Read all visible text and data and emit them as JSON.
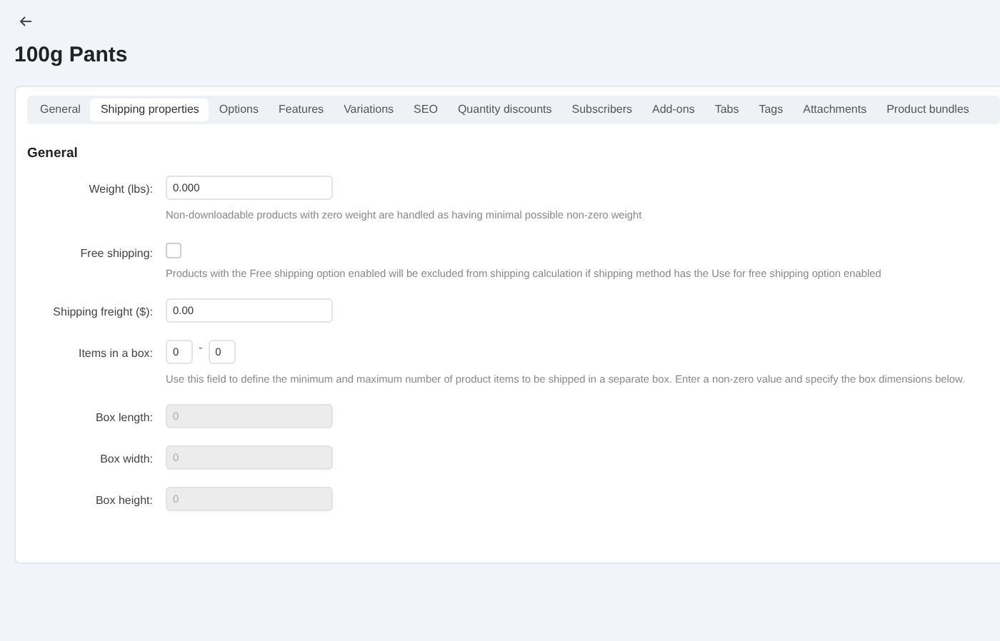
{
  "header": {
    "title": "100g Pants"
  },
  "tabs": [
    {
      "label": "General",
      "selected": false
    },
    {
      "label": "Shipping properties",
      "selected": true
    },
    {
      "label": "Options",
      "selected": false
    },
    {
      "label": "Features",
      "selected": false
    },
    {
      "label": "Variations",
      "selected": false
    },
    {
      "label": "SEO",
      "selected": false
    },
    {
      "label": "Quantity discounts",
      "selected": false
    },
    {
      "label": "Subscribers",
      "selected": false
    },
    {
      "label": "Add-ons",
      "selected": false
    },
    {
      "label": "Tabs",
      "selected": false
    },
    {
      "label": "Tags",
      "selected": false
    },
    {
      "label": "Attachments",
      "selected": false
    },
    {
      "label": "Product bundles",
      "selected": false
    }
  ],
  "section": {
    "title": "General"
  },
  "fields": [
    {
      "kind": "text",
      "label": "Weight (lbs):",
      "value": "0.000",
      "disabled": false,
      "hint": "Non-downloadable products with zero weight are handled as having minimal possible non-zero weight"
    },
    {
      "kind": "checkbox",
      "label": "Free shipping:",
      "checked": false,
      "hint": "Products with the Free shipping option enabled will be excluded from shipping calculation if shipping method has the Use for free shipping option enabled"
    },
    {
      "kind": "text",
      "label": "Shipping freight ($):",
      "value": "0.00",
      "disabled": false
    },
    {
      "kind": "range",
      "label": "Items in a box:",
      "min_value": "0",
      "separator": "-",
      "max_value": "0",
      "hint": "Use this field to define the minimum and maximum number of product items to be shipped in a separate box. Enter a non-zero value and specify the box dimensions below."
    },
    {
      "kind": "text",
      "label": "Box length:",
      "value": "0",
      "disabled": true
    },
    {
      "kind": "text",
      "label": "Box width:",
      "value": "0",
      "disabled": true
    },
    {
      "kind": "text",
      "label": "Box height:",
      "value": "0",
      "disabled": true
    }
  ]
}
